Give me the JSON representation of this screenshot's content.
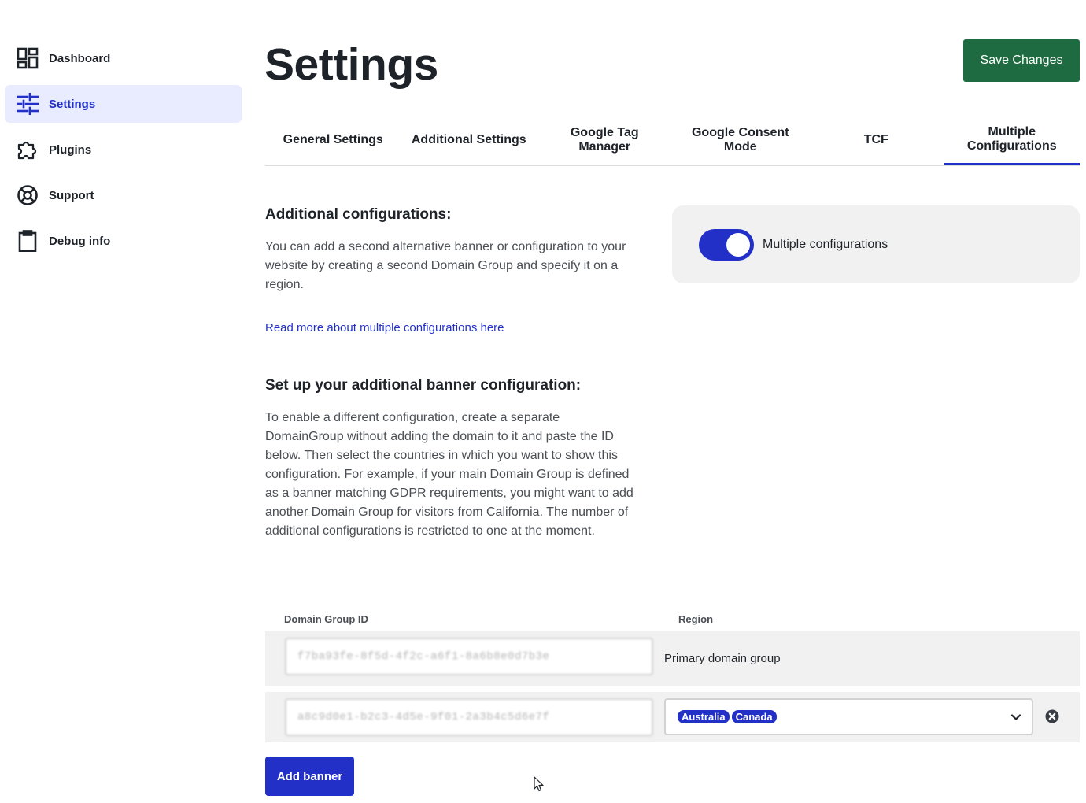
{
  "sidebar": {
    "items": [
      {
        "label": "Dashboard",
        "icon": "dashboard-icon"
      },
      {
        "label": "Settings",
        "icon": "sliders-icon"
      },
      {
        "label": "Plugins",
        "icon": "puzzle-icon"
      },
      {
        "label": "Support",
        "icon": "lifebuoy-icon"
      },
      {
        "label": "Debug info",
        "icon": "clipboard-icon"
      }
    ]
  },
  "header": {
    "title": "Settings",
    "save_label": "Save Changes"
  },
  "tabs": [
    {
      "label": "General Settings"
    },
    {
      "label": "Additional Settings"
    },
    {
      "label": "Google Tag Manager"
    },
    {
      "label": "Google Consent Mode"
    },
    {
      "label": "TCF"
    },
    {
      "label": "Multiple Configurations"
    }
  ],
  "content": {
    "section1_title": "Additional configurations:",
    "section1_text": "You can add a second alternative banner or configuration to your website by creating a second Domain Group and specify it on a region.",
    "link_text": "Read more about multiple configurations here",
    "section2_title": "Set up your additional banner configuration:",
    "section2_text": "To enable a different configuration, create a separate DomainGroup without adding the domain to it and paste the ID below. Then select the countries in which you want to show this configuration. For example, if your main Domain Group is defined as a banner matching GDPR requirements, you might want to add another Domain Group for visitors from California. The number of additional configurations is restricted to one at the moment.",
    "toggle_label": "Multiple configurations"
  },
  "table": {
    "col_domain": "Domain Group ID",
    "col_region": "Region",
    "rows": [
      {
        "id": "f7ba93fe-8f5d-4f2c-a6f1-8a6b8e0d7b3e",
        "region_text": "Primary domain group"
      },
      {
        "id": "a8c9d0e1-b2c3-4d5e-9f01-2a3b4c5d6e7f",
        "regions": [
          "Australia",
          "Canada"
        ]
      }
    ]
  },
  "add_banner_label": "Add banner",
  "colors": {
    "accent": "#2230c8",
    "save_button": "#1f6b41",
    "active_nav_bg": "#e9ecfe"
  }
}
